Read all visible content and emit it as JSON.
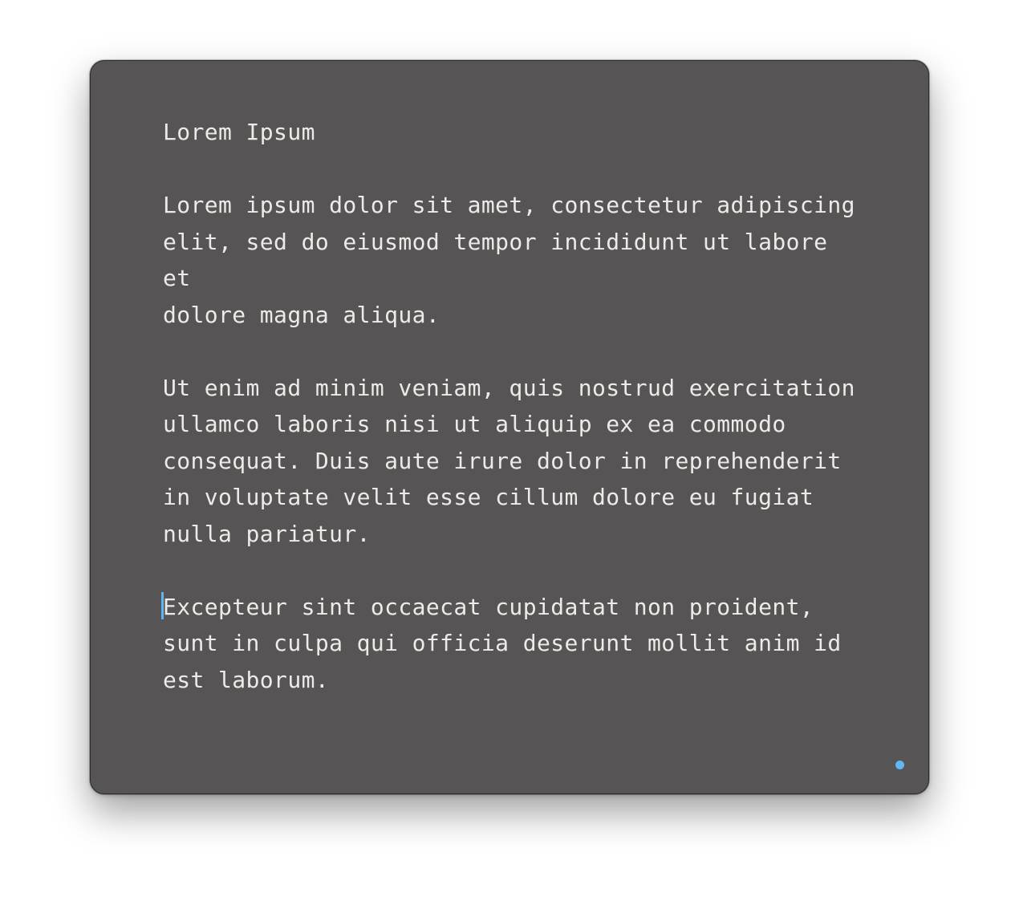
{
  "document": {
    "title": "Lorem Ipsum",
    "paragraphs": [
      "Lorem ipsum dolor sit amet, consectetur adipiscing\nelit, sed do eiusmod tempor incididunt ut labore et\ndolore magna aliqua.",
      "Ut enim ad minim veniam, quis nostrud exercitation\nullamco laboris nisi ut aliquip ex ea commodo\nconsequat. Duis aute irure dolor in reprehenderit\nin voluptate velit esse cillum dolore eu fugiat\nnulla pariatur.",
      "Excepteur sint occaecat cupidatat non proident,\nsunt in culpa qui officia deserunt mollit anim id\nest laborum."
    ]
  },
  "colors": {
    "background": "#565455",
    "text": "#eeeae6",
    "cursor": "#5fb4f5",
    "status_dot": "#62b6f5"
  }
}
